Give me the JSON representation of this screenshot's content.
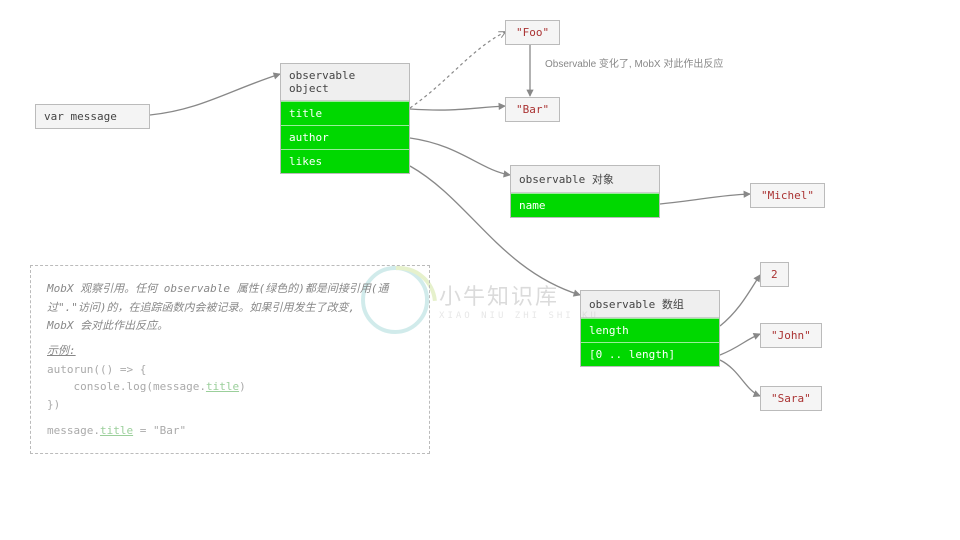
{
  "varBox": "var message",
  "objTable": {
    "title": "observable object",
    "rows": [
      "title",
      "author",
      "likes"
    ]
  },
  "authorTable": {
    "title": "observable  对象",
    "rows": [
      "name"
    ]
  },
  "arrayTable": {
    "title": "observable  数组",
    "rows": [
      "length",
      "[0 .. length]"
    ]
  },
  "values": {
    "foo": "\"Foo\"",
    "bar": "\"Bar\"",
    "michel": "\"Michel\"",
    "two": "2",
    "john": "\"John\"",
    "sara": "\"Sara\""
  },
  "caption": "Observable 变化了, MobX 对此作出反应",
  "note": {
    "p1_a": "MobX 观察引用。任何 observable 属性(绿色的)都是间接引用(通",
    "p1_b": "过\".\"访问)的，在追踪函数内会被记录。如果引用发生了改变,",
    "p1_c": "MobX 会对此作出反应。",
    "exampleLabel": "示例:",
    "code1a": "autorun(() => {",
    "code1b": "    console.log(message.",
    "code1b_u": "title",
    "code1b_c": ")",
    "code1c": "})",
    "code2a": "message.",
    "code2a_u": "title",
    "code2b": " = \"Bar\""
  },
  "watermark": {
    "cn": "小牛知识库",
    "en": "XIAO NIU ZHI SHI KU"
  },
  "colors": {
    "green": "#00d800",
    "gray": "#888",
    "maroon": "#a33"
  }
}
